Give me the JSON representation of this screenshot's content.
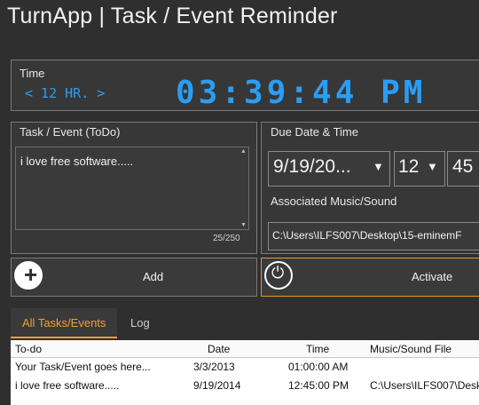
{
  "window": {
    "title": "TurnApp | Task / Event Reminder"
  },
  "time": {
    "label": "Time",
    "mode_display": "< 12 HR. >",
    "clock": "03:39:44 PM"
  },
  "task": {
    "label": "Task / Event (ToDo)",
    "value": "i love free software.....",
    "char_count": "25/250"
  },
  "due": {
    "label": "Due Date & Time",
    "date": "9/19/20...",
    "hour": "12",
    "minute": "45",
    "music_label": "Associated Music/Sound",
    "music_value": "C:\\Users\\ILFS007\\Desktop\\15-eminemF"
  },
  "buttons": {
    "add": "Add",
    "activate": "Activate"
  },
  "tabs": [
    {
      "label": "All Tasks/Events",
      "active": true
    },
    {
      "label": "Log",
      "active": false
    }
  ],
  "table": {
    "columns": [
      "To-do",
      "Date",
      "Time",
      "Music/Sound File"
    ],
    "rows": [
      [
        "Your Task/Event goes here...",
        "3/3/2013",
        "01:00:00 AM",
        ""
      ],
      [
        "i love free software.....",
        "9/19/2014",
        "12:45:00 PM",
        "C:\\Users\\ILFS007\\Desk"
      ]
    ]
  },
  "icons": {
    "add": "plus-circle-icon",
    "activate": "power-icon",
    "dropdown": "triangle-down-icon"
  },
  "colors": {
    "background": "#2f2f2f",
    "clock": "#2a9df4",
    "accent": "#f0a030",
    "activate_border": "#e59a2a"
  }
}
